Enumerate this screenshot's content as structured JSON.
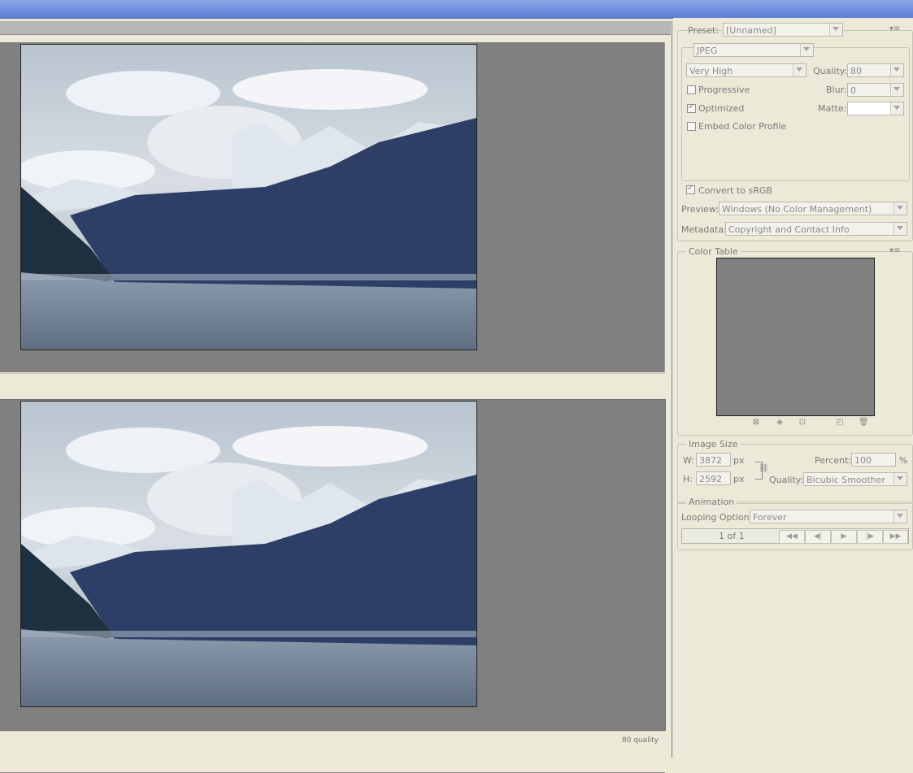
{
  "preview": {
    "quality_caption": "80 quality"
  },
  "settings": {
    "preset_label": "Preset:",
    "preset_value": "[Unnamed]",
    "format_value": "JPEG",
    "compression_value": "Very High",
    "quality_label": "Quality:",
    "quality_value": "80",
    "progressive_label": "Progressive",
    "blur_label": "Blur:",
    "blur_value": "0",
    "optimized_label": "Optimized",
    "matte_label": "Matte:",
    "embed_label": "Embed Color Profile",
    "convert_label": "Convert to sRGB",
    "preview_label": "Preview:",
    "preview_value": "Windows (No Color Management)",
    "metadata_label": "Metadata:",
    "metadata_value": "Copyright and Contact Info"
  },
  "color_table": {
    "title": "Color Table"
  },
  "image_size": {
    "title": "Image Size",
    "w_label": "W:",
    "w_value": "3872",
    "h_label": "H:",
    "h_value": "2592",
    "unit": "px",
    "percent_label": "Percent:",
    "percent_value": "100",
    "percent_unit": "%",
    "quality_label": "Quality:",
    "quality_value": "Bicubic Smoother"
  },
  "animation": {
    "title": "Animation",
    "looping_label": "Looping Options:",
    "looping_value": "Forever",
    "frame_counter": "1 of 1"
  },
  "icons": {
    "panel_menu": "panel-menu-icon",
    "caret": "caret-down-icon"
  }
}
